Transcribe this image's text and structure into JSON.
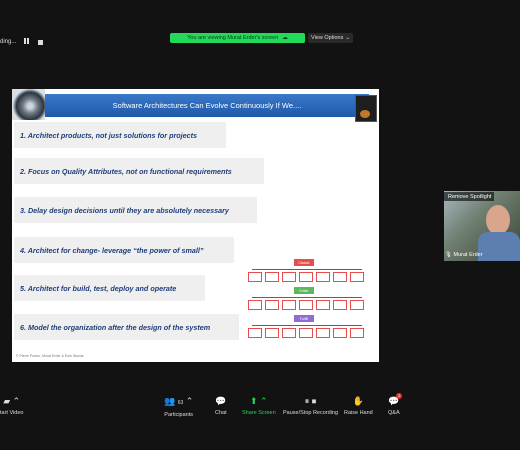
{
  "top": {
    "recording_label": "ding...",
    "viewing_banner": "You are viewing Murat Erder's screen",
    "view_options": "View Options"
  },
  "slide": {
    "title": "Software Architectures Can Evolve Continuously If We....",
    "points": [
      "1. Architect products, not just solutions for  projects",
      "2. Focus on Quality Attributes, not on functional requirements",
      "3. Delay design decisions until they are absolutely necessary",
      "4. Architect for change- leverage “the power of small”",
      "5. Architect for build, test, deploy and operate",
      "6. Model the organization after the design of the system"
    ],
    "copyright": "© Pierre Pureur, Murat Erder & Eoin Woods",
    "org_labels": [
      "Classic",
      "Emler",
      "Fulfill"
    ]
  },
  "video": {
    "remove_spotlight": "Remove Spotlight",
    "name": "Murat Erder"
  },
  "toolbar": {
    "start_video": "tart Video",
    "participants": "Participants",
    "participant_count": "63",
    "chat": "Chat",
    "share_screen": "Share Screen",
    "pause_recording": "Pause/Stop Recording",
    "raise_hand": "Raise Hand",
    "qa": "Q&A",
    "qa_badge": "2"
  },
  "colors": {
    "accent_green": "#23d959",
    "slide_blue": "#1e5aa8",
    "point_text": "#1f3e78"
  }
}
